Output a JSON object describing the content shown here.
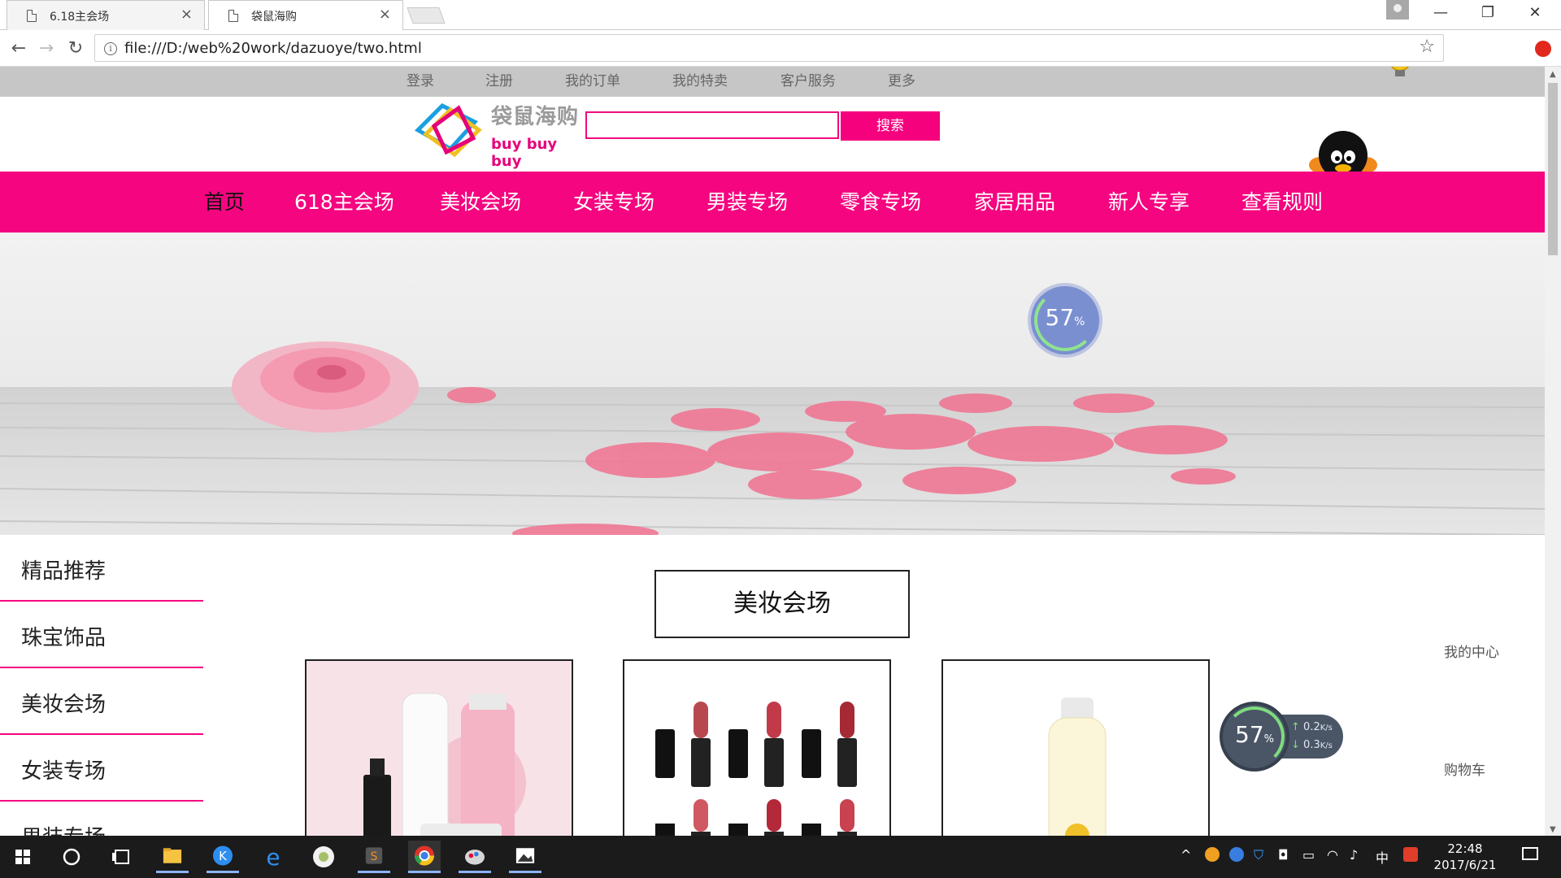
{
  "browser": {
    "tabs": [
      {
        "title": "6.18主会场",
        "active": false
      },
      {
        "title": "袋鼠海购",
        "active": true
      }
    ],
    "url": "file:///D:/web%20work/dazuoye/two.html",
    "window_buttons": {
      "minimize": "—",
      "restore": "❐",
      "close": "✕"
    }
  },
  "page": {
    "top_links": [
      "登录",
      "注册",
      "我的订单",
      "我的特卖",
      "客户服务",
      "更多"
    ],
    "logo": {
      "cn": "袋鼠海购",
      "en": "buy buy buy"
    },
    "search": {
      "button": "搜索",
      "value": ""
    },
    "main_nav": [
      "首页",
      "618主会场",
      "美妆会场",
      "女装专场",
      "男装专场",
      "零食专场",
      "家居用品",
      "新人专享",
      "查看规则"
    ],
    "float_ball": {
      "number": "57",
      "unit": "%"
    },
    "sidebar": [
      "精品推荐",
      "珠宝饰品",
      "美妆会场",
      "女装专场",
      "男装专场"
    ],
    "section_title": "美妆会场",
    "right_links": [
      "我的中心",
      "购物车"
    ],
    "speed_widget": {
      "number": "57",
      "unit": "%",
      "up": "0.2",
      "down": "0.3",
      "rate_unit": "K/s"
    }
  },
  "taskbar": {
    "time": "22:48",
    "date": "2017/6/21",
    "ime": "中"
  },
  "colors": {
    "accent": "#f5057f",
    "top_bar": "#c6c6c6"
  }
}
